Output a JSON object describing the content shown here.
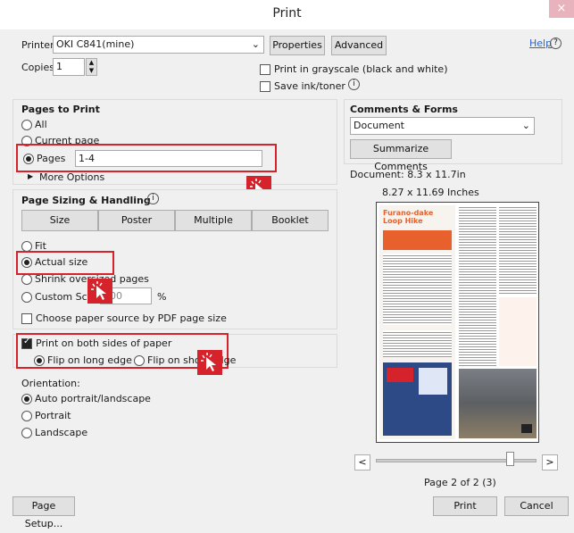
{
  "window": {
    "title": "Print",
    "close_label": "×"
  },
  "printer": {
    "label": "Printer:",
    "value": "OKI C841(mine)",
    "properties": "Properties",
    "advanced": "Advanced",
    "help": "Help",
    "copies_label": "Copies:",
    "copies_value": "1",
    "grayscale": "Print in grayscale (black and white)",
    "save_ink": "Save ink/toner"
  },
  "pages_to_print": {
    "heading": "Pages to Print",
    "all": "All",
    "current": "Current page",
    "pages": "Pages",
    "pages_value": "1-4",
    "more_options": "More Options"
  },
  "sizing": {
    "heading": "Page Sizing & Handling",
    "tabs": [
      "Size",
      "Poster",
      "Multiple",
      "Booklet"
    ],
    "fit": "Fit",
    "actual": "Actual size",
    "shrink": "Shrink oversized pages",
    "custom_scale": "Custom Scale:",
    "custom_scale_value": "100",
    "percent": "%",
    "paper_source": "Choose paper source by PDF page size"
  },
  "duplex": {
    "both_sides": "Print on both sides of paper",
    "long_edge": "Flip on long edge",
    "short_edge": "Flip on short edge"
  },
  "orientation": {
    "heading": "Orientation:",
    "auto": "Auto portrait/landscape",
    "portrait": "Portrait",
    "landscape": "Landscape"
  },
  "comments": {
    "heading": "Comments & Forms",
    "value": "Document",
    "summarize": "Summarize Comments"
  },
  "preview": {
    "doc_size": "Document: 8.3 x 11.7in",
    "paper_size": "8.27 x 11.69 Inches",
    "page_title": "Furano-dake Loop Hike",
    "page_of": "Page 2 of 2 (3)",
    "prev": "<",
    "next": ">"
  },
  "footer": {
    "page_setup": "Page Setup...",
    "print": "Print",
    "cancel": "Cancel"
  },
  "colors": {
    "accent": "#d6222a",
    "guide_orange": "#e8612c"
  }
}
